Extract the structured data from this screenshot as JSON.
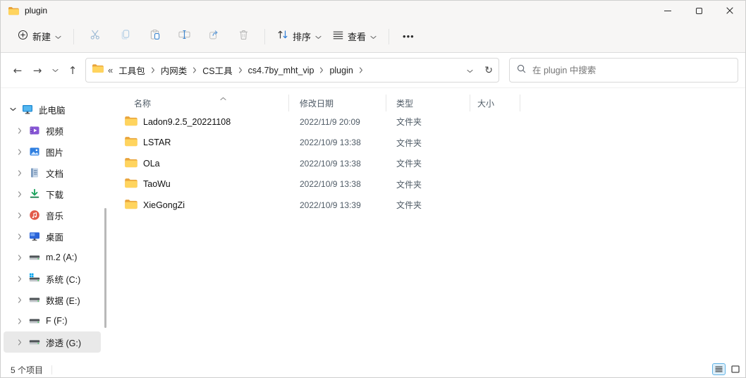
{
  "window": {
    "title": "plugin"
  },
  "icons": {
    "back": "←",
    "forward": "→",
    "up": "↑",
    "refresh": "↻",
    "overflow": "«",
    "more": "•••"
  },
  "toolbar": {
    "new_label": "新建",
    "sort_label": "排序",
    "view_label": "查看"
  },
  "address": {
    "crumbs": [
      "工具包",
      "内网类",
      "CS工具",
      "cs4.7by_mht_vip",
      "plugin"
    ]
  },
  "search": {
    "placeholder": "在 plugin 中搜索"
  },
  "sidebar": {
    "items": [
      {
        "label": "此电脑"
      },
      {
        "label": "视频"
      },
      {
        "label": "图片"
      },
      {
        "label": "文档"
      },
      {
        "label": "下载"
      },
      {
        "label": "音乐"
      },
      {
        "label": "桌面"
      },
      {
        "label": "m.2 (A:)"
      },
      {
        "label": "系统 (C:)"
      },
      {
        "label": "数据 (E:)"
      },
      {
        "label": "F (F:)"
      },
      {
        "label": "渗透 (G:)",
        "selected": true
      }
    ]
  },
  "files": {
    "columns": {
      "name": "名称",
      "date": "修改日期",
      "type": "类型",
      "size": "大小"
    },
    "rows": [
      {
        "name": "Ladon9.2.5_20221108",
        "date": "2022/11/9 20:09",
        "type": "文件夹",
        "size": ""
      },
      {
        "name": "LSTAR",
        "date": "2022/10/9 13:38",
        "type": "文件夹",
        "size": ""
      },
      {
        "name": "OLa",
        "date": "2022/10/9 13:38",
        "type": "文件夹",
        "size": ""
      },
      {
        "name": "TaoWu",
        "date": "2022/10/9 13:38",
        "type": "文件夹",
        "size": ""
      },
      {
        "name": "XieGongZi",
        "date": "2022/10/9 13:39",
        "type": "文件夹",
        "size": ""
      }
    ]
  },
  "statusbar": {
    "count": "5 个项目"
  },
  "colors": {
    "accent": "#2e7cd6",
    "folder_front": "#FFD45E",
    "folder_back": "#E9A43B",
    "selection": "#e9e9e9"
  }
}
